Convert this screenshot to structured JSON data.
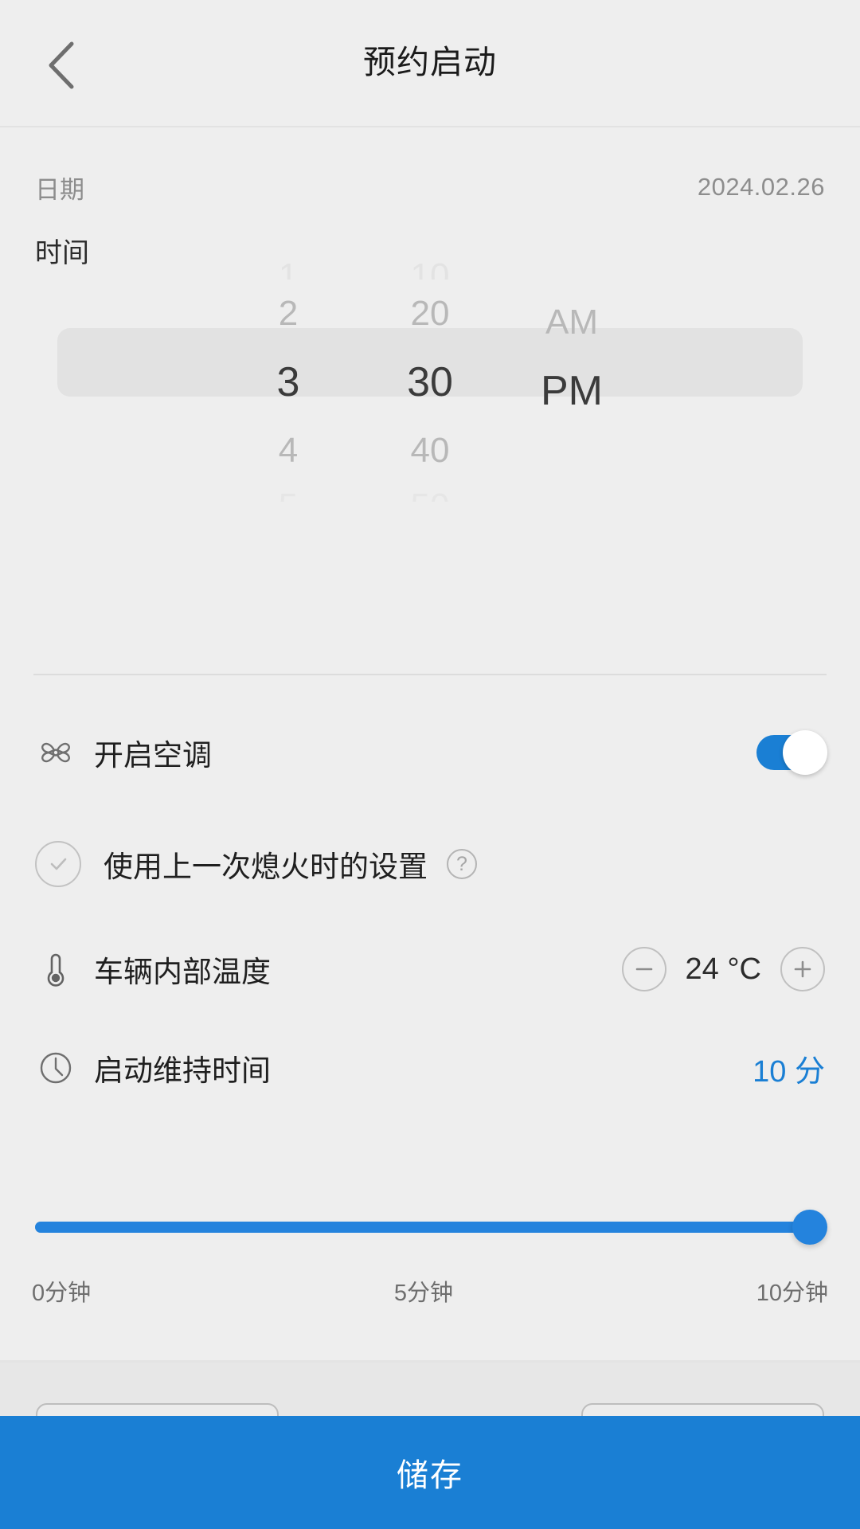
{
  "header": {
    "title": "预约启动",
    "back_icon": "chevron-left-icon"
  },
  "date_row": {
    "label": "日期",
    "value": "2024.02.26"
  },
  "time_section": {
    "label": "时间",
    "picker": {
      "hour": {
        "above_faint": "1",
        "above": "2",
        "selected": "3",
        "below": "4",
        "below_faint": "5"
      },
      "minute": {
        "above_faint": "10",
        "above": "20",
        "selected": "30",
        "below": "40",
        "below_faint": "50"
      },
      "meridiem": {
        "above_faint": "",
        "above": "AM",
        "selected": "PM",
        "below": "",
        "below_faint": ""
      }
    }
  },
  "ac_row": {
    "icon": "fan-icon",
    "label": "开启空调",
    "toggle_on": true
  },
  "last_settings_row": {
    "icon": "check-circle-icon",
    "label": "使用上一次熄火时的设置",
    "help_icon": "question-mark-icon",
    "help_glyph": "?",
    "selected": false
  },
  "temperature_row": {
    "icon": "thermometer-icon",
    "label": "车辆内部温度",
    "decrease_icon": "minus-circle-icon",
    "increase_icon": "plus-circle-icon",
    "value": "24 °C"
  },
  "duration_row": {
    "icon": "clock-icon",
    "label": "启动维持时间",
    "value": "10 分"
  },
  "slider": {
    "min_label": "0分钟",
    "mid_label": "5分钟",
    "max_label": "10分钟",
    "percent": 100
  },
  "save_bar": {
    "label": "储存"
  },
  "colors": {
    "accent_blue": "#1a7fd4",
    "slider_blue": "#2483dd",
    "background": "#eeeeee",
    "panel": "#e7e7e7",
    "highlight": "#e2e2e2"
  }
}
